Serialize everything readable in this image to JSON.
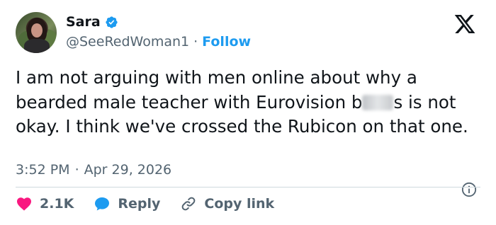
{
  "author": {
    "name": "Sara",
    "handle": "@SeeRedWoman1",
    "separator": "·",
    "follow_label": "Follow"
  },
  "tweet": {
    "text_part1": "I am not arguing with men online about why a bearded male teacher with Eurovision b",
    "text_part2": "s is not okay. I think we've crossed the Rubicon on that one."
  },
  "meta": {
    "time": "3:52 PM",
    "separator": "·",
    "date": "Apr 29, 2026"
  },
  "actions": {
    "likes": "2.1K",
    "reply_label": "Reply",
    "copy_link_label": "Copy link"
  },
  "colors": {
    "accent": "#1d9bf0",
    "like": "#f91880",
    "muted": "#536471",
    "text": "#0f1419"
  },
  "icons": {
    "verified": "verified-badge-icon",
    "logo": "x-logo-icon",
    "info": "info-icon",
    "like": "heart-icon",
    "reply": "speech-bubble-icon",
    "copy_link": "link-icon"
  }
}
